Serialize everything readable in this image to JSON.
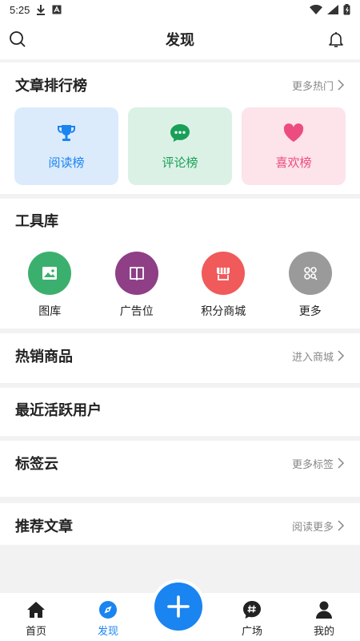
{
  "status": {
    "time": "5:25"
  },
  "header": {
    "title": "发现"
  },
  "rank": {
    "title": "文章排行榜",
    "more": "更多热门",
    "cards": [
      {
        "label": "阅读榜",
        "icon": "trophy-icon",
        "color": "#1a84f0",
        "bg": "#dcebfc"
      },
      {
        "label": "评论榜",
        "icon": "comment-icon",
        "color": "#18a058",
        "bg": "#dcf1e6"
      },
      {
        "label": "喜欢榜",
        "icon": "heart-icon",
        "color": "#ec4c7e",
        "bg": "#fde3ea"
      }
    ]
  },
  "tools": {
    "title": "工具库",
    "items": [
      {
        "label": "图库",
        "icon": "image-icon",
        "color": "#3bb06e"
      },
      {
        "label": "广告位",
        "icon": "book-icon",
        "color": "#8e3f86"
      },
      {
        "label": "积分商城",
        "icon": "store-icon",
        "color": "#f05a5a"
      },
      {
        "label": "更多",
        "icon": "grid-icon",
        "color": "#9a9a9a"
      }
    ]
  },
  "hot_products": {
    "title": "热销商品",
    "more": "进入商城"
  },
  "active_users": {
    "title": "最近活跃用户"
  },
  "tag_cloud": {
    "title": "标签云",
    "more": "更多标签"
  },
  "recommended": {
    "title": "推荐文章",
    "more": "阅读更多"
  },
  "nav": {
    "items": [
      {
        "label": "首页"
      },
      {
        "label": "发现"
      },
      {
        "label": "广场"
      },
      {
        "label": "我的"
      }
    ],
    "accent": "#1a84f0"
  }
}
